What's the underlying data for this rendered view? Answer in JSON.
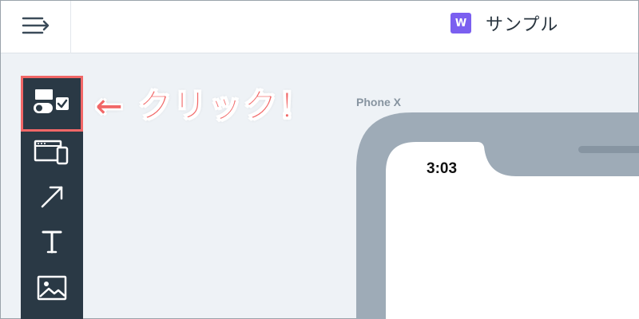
{
  "header": {
    "menu_icon": "menu-collapse-icon",
    "project_badge": "W",
    "project_name": "サンプル",
    "badge_color": "#7b5ff0"
  },
  "toolbar": {
    "tools": [
      {
        "icon": "components-toggle-icon",
        "highlighted": true
      },
      {
        "icon": "device-frames-icon"
      },
      {
        "icon": "arrow-icon"
      },
      {
        "icon": "text-icon"
      },
      {
        "icon": "image-icon"
      }
    ],
    "background": "#2a3945"
  },
  "annotation": {
    "text": "← クリック！",
    "color": "#f16767"
  },
  "canvas": {
    "device_label": "Phone X",
    "status_time": "3:03",
    "frame_color": "#9eabb7"
  }
}
